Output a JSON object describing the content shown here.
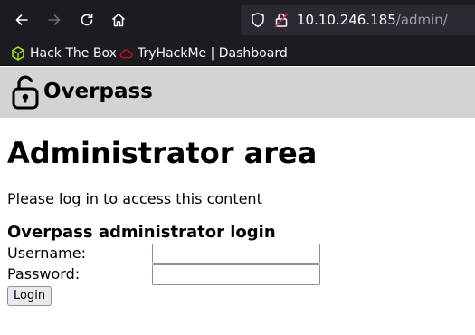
{
  "browser": {
    "url_host": "10.10.246.185",
    "url_path": "/admin/",
    "bookmarks": [
      {
        "label": "Hack The Box",
        "icon": "hackthebox-cube-icon",
        "color": "#9fef00"
      },
      {
        "label": "TryHackMe | Dashboard",
        "icon": "tryhackme-cloud-icon",
        "color": "#c11111"
      }
    ],
    "colors": {
      "toolbar": "#1c1b22",
      "urlbar": "#2b2a33"
    }
  },
  "site": {
    "name": "Overpass",
    "logo_icon": "padlock-icon",
    "header_color": "#d3d3d3"
  },
  "page": {
    "title": "Administrator area",
    "intro": "Please log in to access this content"
  },
  "login_form": {
    "heading": "Overpass administrator login",
    "username_label": "Username:",
    "username_value": "",
    "password_label": "Password:",
    "password_value": "",
    "submit_label": "Login"
  }
}
